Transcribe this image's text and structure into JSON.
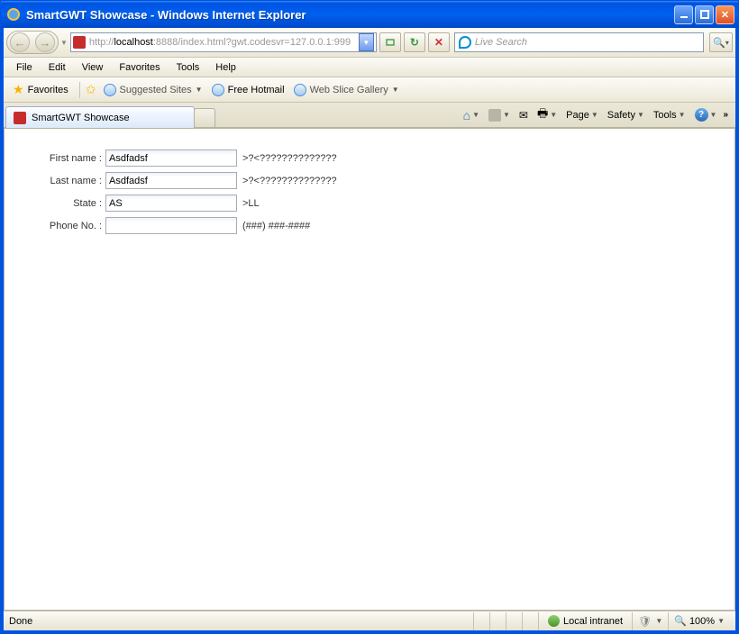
{
  "window": {
    "title": "SmartGWT Showcase - Windows Internet Explorer"
  },
  "nav": {
    "url_prefix": "http://",
    "url_host": "localhost",
    "url_rest": ":8888/index.html?gwt.codesvr=127.0.0.1:999",
    "search_placeholder": "Live Search"
  },
  "menu": {
    "items": [
      "File",
      "Edit",
      "View",
      "Favorites",
      "Tools",
      "Help"
    ]
  },
  "favorites": {
    "label": "Favorites",
    "suggested": "Suggested Sites",
    "hotmail": "Free Hotmail",
    "webslice": "Web Slice Gallery"
  },
  "tabs": {
    "active": "SmartGWT Showcase"
  },
  "cmdbar": {
    "page": "Page",
    "safety": "Safety",
    "tools": "Tools"
  },
  "form": {
    "rows": [
      {
        "label": "First name :",
        "value": "Asdfadsf",
        "hint": ">?<??????????????"
      },
      {
        "label": "Last name :",
        "value": "Asdfadsf",
        "hint": ">?<??????????????"
      },
      {
        "label": "State :",
        "value": "AS",
        "hint": ">LL"
      },
      {
        "label": "Phone No. :",
        "value": "",
        "hint": "(###) ###-####"
      }
    ]
  },
  "status": {
    "left": "Done",
    "zone": "Local intranet",
    "zoom": "100%"
  }
}
